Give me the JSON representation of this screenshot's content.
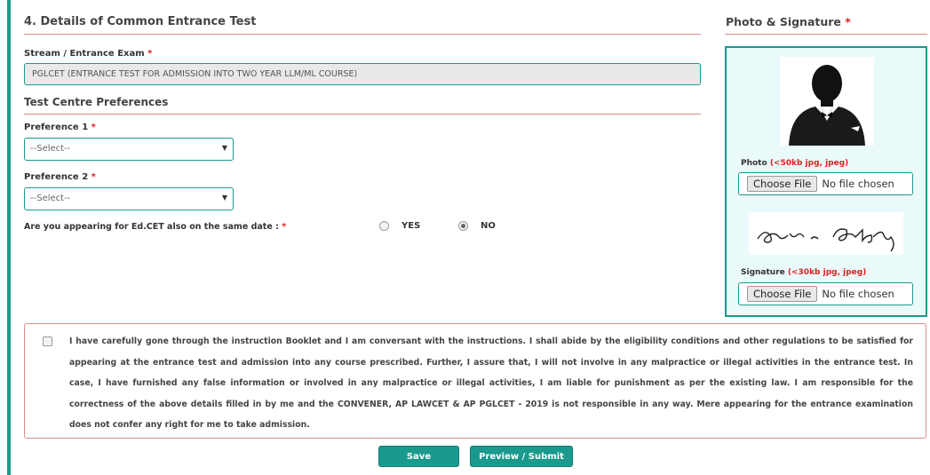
{
  "section": {
    "title": "4. Details of Common Entrance Test"
  },
  "stream": {
    "label": "Stream / Entrance Exam",
    "value": "PGLCET (ENTRANCE TEST FOR ADMISSION INTO TWO YEAR LLM/ML COURSE)"
  },
  "test_centre": {
    "title": "Test Centre Preferences",
    "pref1": {
      "label": "Preference 1",
      "selected": "--Select--"
    },
    "pref2": {
      "label": "Preference 2",
      "selected": "--Select--"
    }
  },
  "edcet": {
    "question": "Are you appearing for Ed.CET also on the same date :",
    "options": [
      "YES",
      "NO"
    ],
    "selected": "NO"
  },
  "required_mark": "*",
  "photo_sig": {
    "title": "Photo & Signature",
    "photo_label": "Photo",
    "photo_hint": "(<50kb jpg, jpeg)",
    "signature_label": "Signature",
    "signature_hint": "(<30kb jpg, jpeg)",
    "choose_file": "Choose File",
    "no_file": "No file chosen"
  },
  "declaration": {
    "text": "I have carefully gone through the instruction Booklet and I am conversant with the instructions. I shall abide by the eligibility conditions and other regulations to be satisfied for appearing at the entrance test and admission into any course prescribed. Further, I assure that, I will not involve in any malpractice or illegal activities in the entrance test. In case, I have furnished any false information or involved in any malpractice or illegal activities, I am liable for punishment as per the existing law. I am responsible for the correctness of the above details filled in by me and the CONVENER, AP LAWCET & AP PGLCET - 2019 is not responsible in any way. Mere appearing for the entrance examination does not confer any right for me to take admission.",
    "checked": false
  },
  "buttons": {
    "save": "Save",
    "preview": "Preview / Submit"
  },
  "colors": {
    "accent": "#1a9a8c",
    "required": "#e02020",
    "divider": "#e08a8a"
  }
}
